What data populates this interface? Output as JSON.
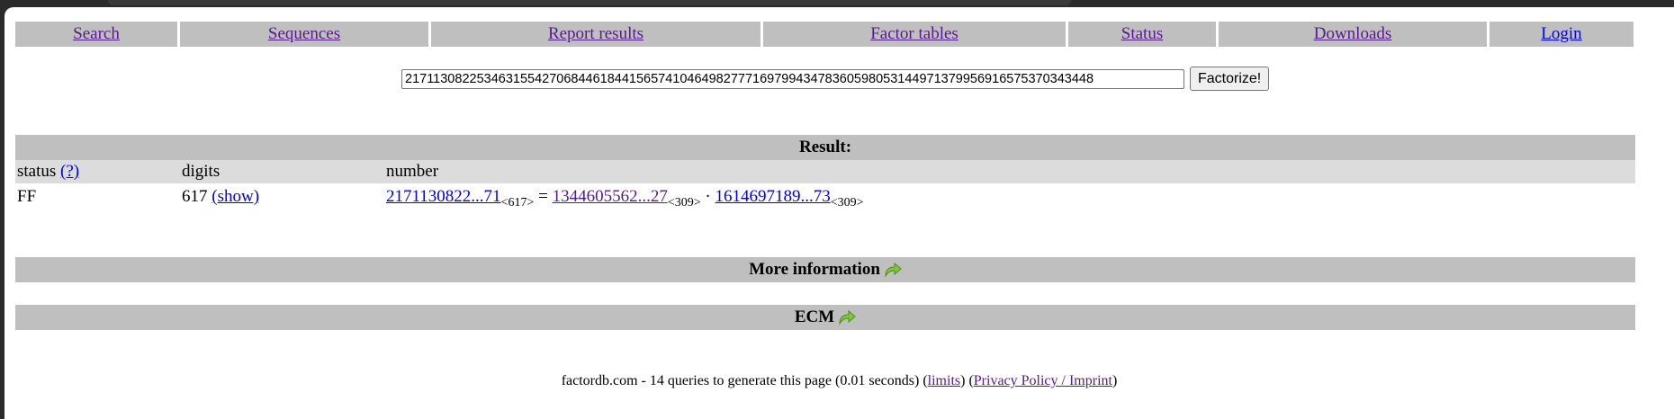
{
  "nav": {
    "items": [
      {
        "label": "Search"
      },
      {
        "label": "Sequences"
      },
      {
        "label": "Report results"
      },
      {
        "label": "Factor tables"
      },
      {
        "label": "Status"
      },
      {
        "label": "Downloads"
      },
      {
        "label": "Login"
      }
    ]
  },
  "search": {
    "value": "21711308225346315542706844618441565741046498277716979943478360598053144971379956916575370343448",
    "button_label": "Factorize!"
  },
  "result": {
    "header": "Result:",
    "columns": {
      "status": "status",
      "status_help": "(?)",
      "digits": "digits",
      "number": "number"
    },
    "row": {
      "status": "FF",
      "digits": "617",
      "show_link": "(show)",
      "number_link": "2171130822...71",
      "number_digits": "<617>",
      "equals": "=",
      "factor1": "1344605562...27",
      "factor1_digits": "<309>",
      "times": "·",
      "factor2": "1614697189...73",
      "factor2_digits": "<309>"
    }
  },
  "more_info": {
    "label": "More information"
  },
  "ecm": {
    "label": "ECM"
  },
  "footer": {
    "text": "factordb.com - 14 queries to generate this page (0.01 seconds) (",
    "limits": "limits",
    "between": ") (",
    "privacy": "Privacy Policy / Imprint",
    "end": ")"
  },
  "colors": {
    "band": "#bfbfbf",
    "subheader": "#dcdcdc",
    "link": "#0000ee",
    "icon": "#7ec832"
  }
}
